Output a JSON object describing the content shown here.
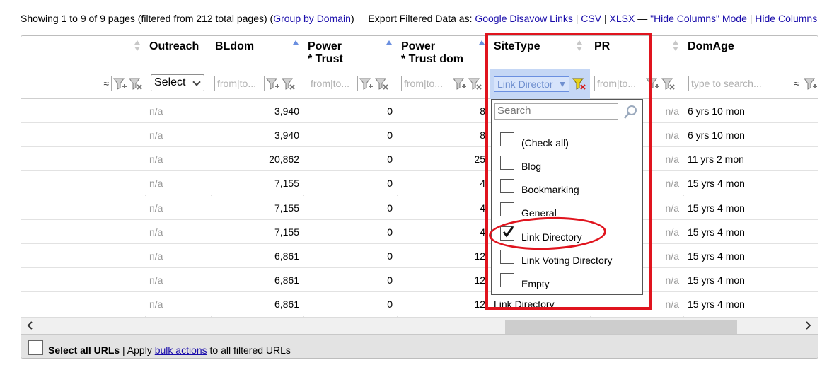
{
  "topbar": {
    "showing": "Showing 1 to 9 of 9 pages (filtered from 212 total pages) (",
    "group_by_domain": "Group by Domain",
    "close_paren": ")",
    "export_label": "Export Filtered Data as:",
    "google_disavow": "Google Disavow Links",
    "sep1": "|",
    "csv": "CSV",
    "sep2": "|",
    "xlsx": "XLSX",
    "dash": "—",
    "hide_columns_mode": "\"Hide Columns\" Mode",
    "sep3": "|",
    "hide_columns": "Hide Columns"
  },
  "columns": {
    "outreach": "Outreach",
    "bldom": "BLdom",
    "power_trust_1": "Power",
    "power_trust_2": "* Trust",
    "power_trust_dom_1": "Power",
    "power_trust_dom_2": "* Trust dom",
    "sitetype": "SiteType",
    "pr": "PR",
    "domage": "DomAge"
  },
  "filters": {
    "text_approx": "≈",
    "outreach_select": "Select",
    "from_to": "from|to...",
    "sitetype_value": "Link Director",
    "domage_placeholder": "type to search..."
  },
  "rows": [
    {
      "outreach": "n/a",
      "bldom": "3,940",
      "power_trust": "0",
      "ptd": "8",
      "sitetype": "",
      "pr": "n/a",
      "domage": "6 yrs 10 mon"
    },
    {
      "outreach": "n/a",
      "bldom": "3,940",
      "power_trust": "0",
      "ptd": "8",
      "sitetype": "",
      "pr": "n/a",
      "domage": "6 yrs 10 mon"
    },
    {
      "outreach": "n/a",
      "bldom": "20,862",
      "power_trust": "0",
      "ptd": "25",
      "sitetype": "",
      "pr": "n/a",
      "domage": "11 yrs 2 mon"
    },
    {
      "outreach": "n/a",
      "bldom": "7,155",
      "power_trust": "0",
      "ptd": "4",
      "sitetype": "",
      "pr": "n/a",
      "domage": "15 yrs 4 mon"
    },
    {
      "outreach": "n/a",
      "bldom": "7,155",
      "power_trust": "0",
      "ptd": "4",
      "sitetype": "",
      "pr": "n/a",
      "domage": "15 yrs 4 mon"
    },
    {
      "outreach": "n/a",
      "bldom": "7,155",
      "power_trust": "0",
      "ptd": "4",
      "sitetype": "",
      "pr": "n/a",
      "domage": "15 yrs 4 mon"
    },
    {
      "outreach": "n/a",
      "bldom": "6,861",
      "power_trust": "0",
      "ptd": "12",
      "sitetype": "",
      "pr": "n/a",
      "domage": "15 yrs 4 mon"
    },
    {
      "outreach": "n/a",
      "bldom": "6,861",
      "power_trust": "0",
      "ptd": "12",
      "sitetype": "",
      "pr": "n/a",
      "domage": "15 yrs 4 mon"
    },
    {
      "outreach": "n/a",
      "bldom": "6,861",
      "power_trust": "0",
      "ptd": "12",
      "sitetype": "Link Directory",
      "pr": "n/a",
      "domage": "15 yrs 4 mon"
    }
  ],
  "dropdown": {
    "search_placeholder": "Search",
    "items": [
      {
        "label": "(Check all)",
        "checked": false
      },
      {
        "label": "Blog",
        "checked": false
      },
      {
        "label": "Bookmarking",
        "checked": false
      },
      {
        "label": "General",
        "checked": false
      },
      {
        "label": "Link Directory",
        "checked": true
      },
      {
        "label": "Link Voting Directory",
        "checked": false
      },
      {
        "label": "Empty",
        "checked": false
      }
    ]
  },
  "footer": {
    "select_all": "Select all URLs",
    "sep": " | Apply ",
    "bulk_actions": "bulk actions",
    "rest": " to all filtered URLs"
  },
  "colors": {
    "highlight_red": "#e0141e",
    "link_blue": "#1a0dab",
    "filter_active_bg": "#c5d7f5"
  }
}
